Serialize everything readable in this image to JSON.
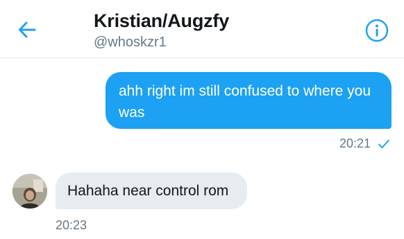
{
  "colors": {
    "accent": "#1da1f2",
    "outgoing_bubble": "#1da1f2",
    "incoming_bubble": "#e6ecf0",
    "secondary_text": "#657786",
    "primary_text": "#14171a"
  },
  "header": {
    "title": "Kristian/Augzfy",
    "handle": "@whoskzr1",
    "back_icon": "arrow-left-icon",
    "info_icon": "info-icon"
  },
  "messages": [
    {
      "direction": "outgoing",
      "text": "ahh right im still confused to where you was",
      "time": "20:21",
      "status_icon": "check-icon"
    },
    {
      "direction": "incoming",
      "text": "Hahaha near control rom",
      "time": "20:23",
      "avatar_icon": "avatar"
    }
  ]
}
